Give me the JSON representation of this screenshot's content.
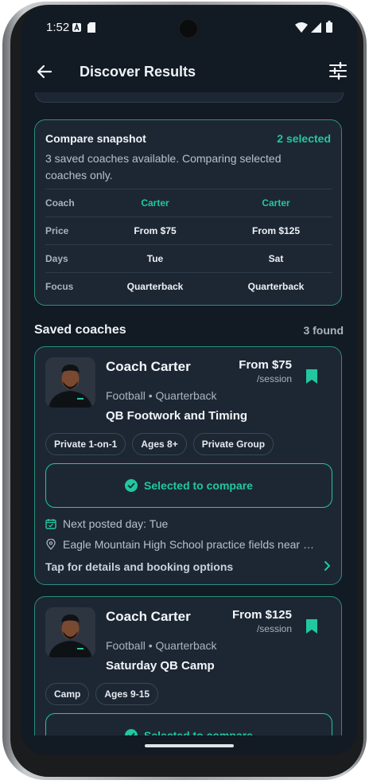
{
  "status": {
    "time": "1:52"
  },
  "appbar": {
    "title": "Discover Results"
  },
  "compare": {
    "title": "Compare snapshot",
    "selected": "2 selected",
    "description": "3 saved coaches available. Comparing selected coaches only.",
    "rows": [
      {
        "label": "Coach",
        "a": "Carter",
        "b": "Carter"
      },
      {
        "label": "Price",
        "a": "From $75",
        "b": "From $125"
      },
      {
        "label": "Days",
        "a": "Tue",
        "b": "Sat"
      },
      {
        "label": "Focus",
        "a": "Quarterback",
        "b": "Quarterback"
      }
    ]
  },
  "saved": {
    "heading": "Saved coaches",
    "count": "3 found"
  },
  "cards": [
    {
      "name": "Coach Carter",
      "price": "From $75",
      "per": "/session",
      "sport": "Football • Quarterback",
      "program": "QB Footwork and Timing",
      "chips": [
        "Private 1-on-1",
        "Ages 8+",
        "Private Group"
      ],
      "select_label": "Selected to compare",
      "next_day": "Next posted day: Tue",
      "location": "Eagle Mountain High School practice fields near …",
      "tap": "Tap for details and booking options"
    },
    {
      "name": "Coach Carter",
      "price": "From $125",
      "per": "/session",
      "sport": "Football • Quarterback",
      "program": "Saturday QB Camp",
      "chips": [
        "Camp",
        "Ages 9-15"
      ],
      "select_label": "Selected to compare"
    }
  ],
  "colors": {
    "accent": "#21c7a1",
    "background": "#121a24",
    "card": "#1d2734"
  }
}
